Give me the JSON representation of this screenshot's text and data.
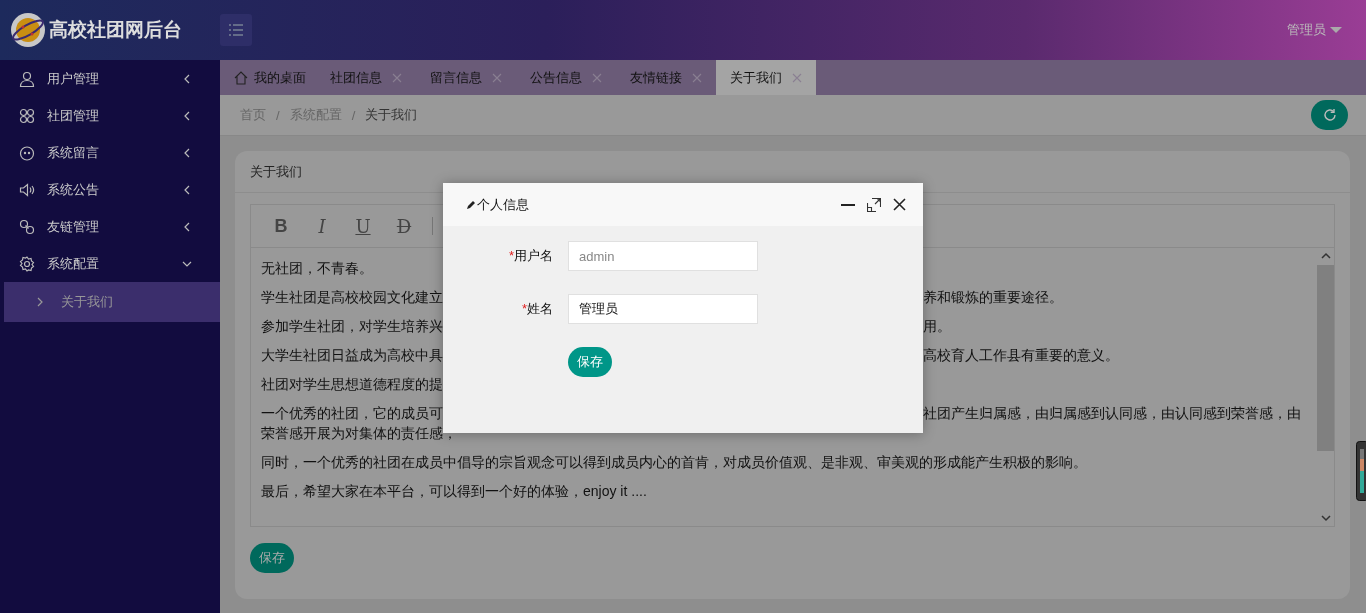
{
  "header": {
    "title": "高校社团网后台",
    "user": "管理员"
  },
  "sidebar": {
    "items": [
      {
        "label": "用户管理",
        "expanded": false
      },
      {
        "label": "社团管理",
        "expanded": false
      },
      {
        "label": "系统留言",
        "expanded": false
      },
      {
        "label": "系统公告",
        "expanded": false
      },
      {
        "label": "友链管理",
        "expanded": false
      },
      {
        "label": "系统配置",
        "expanded": true,
        "children": [
          {
            "label": "关于我们",
            "selected": true
          }
        ]
      }
    ]
  },
  "tabs": [
    {
      "label": "我的桌面",
      "kind": "home",
      "selected": false
    },
    {
      "label": "社团信息",
      "kind": "closable",
      "selected": false
    },
    {
      "label": "留言信息",
      "kind": "closable",
      "selected": false
    },
    {
      "label": "公告信息",
      "kind": "closable",
      "selected": false
    },
    {
      "label": "友情链接",
      "kind": "closable",
      "selected": false
    },
    {
      "label": "关于我们",
      "kind": "closable",
      "selected": true
    }
  ],
  "breadcrumb": [
    {
      "text": "首页",
      "kind": "link"
    },
    {
      "text": "/",
      "kind": "sep"
    },
    {
      "text": "系统配置",
      "kind": "link"
    },
    {
      "text": "/",
      "kind": "sep"
    },
    {
      "text": "关于我们",
      "kind": "current"
    }
  ],
  "card": {
    "title": "关于我们",
    "toolbar": [
      {
        "text": "B",
        "kind": "bold"
      },
      {
        "text": "I",
        "kind": "italic"
      },
      {
        "text": "U",
        "kind": "underline"
      },
      {
        "text": "D",
        "kind": "strike"
      }
    ],
    "paragraphs": [
      {
        "lines": [
          {
            "left": "无社团，不青春。"
          }
        ]
      },
      {
        "lines": [
          {
            "left": "学生社团是高校校园文化建立",
            "right": "养和锻炼的重要途径。"
          }
        ]
      },
      {
        "lines": [
          {
            "left": "参加学生社团，对学生培养兴",
            "right": "用。"
          }
        ]
      },
      {
        "lines": [
          {
            "left": "大学生社团日益成为高校中具",
            "right": "高校育人工作县有重要的意义。"
          }
        ]
      },
      {
        "lines": [
          {
            "left": "社团对学生思想道德程度的提"
          }
        ]
      },
      {
        "lines": [
          {
            "left": "一个优秀的社团，它的成员可",
            "right": "社团产生归属感，由归属感到认同感，由认同感到荣誉感，由"
          },
          {
            "left": "荣誉感开展为对集体的责任感，"
          }
        ]
      },
      {
        "lines": [
          {
            "left": "同时，一个优秀的社团在成员中倡导的宗旨观念可以得到成员内心的首肯，对成员价值观、是非观、审美观的形成能产生积极的影响。"
          }
        ]
      },
      {
        "lines": [
          {
            "left": "最后，希望大家在本平台，可以得到一个好的体验，enjoy it ...."
          }
        ]
      }
    ],
    "save": "保存"
  },
  "modal": {
    "title": "个人信息",
    "fields": [
      {
        "mark": "*",
        "label": "用户名",
        "value": "admin",
        "disabled": true
      },
      {
        "mark": "*",
        "label": "姓名",
        "value": "管理员",
        "disabled": false
      }
    ],
    "save": "保存"
  }
}
